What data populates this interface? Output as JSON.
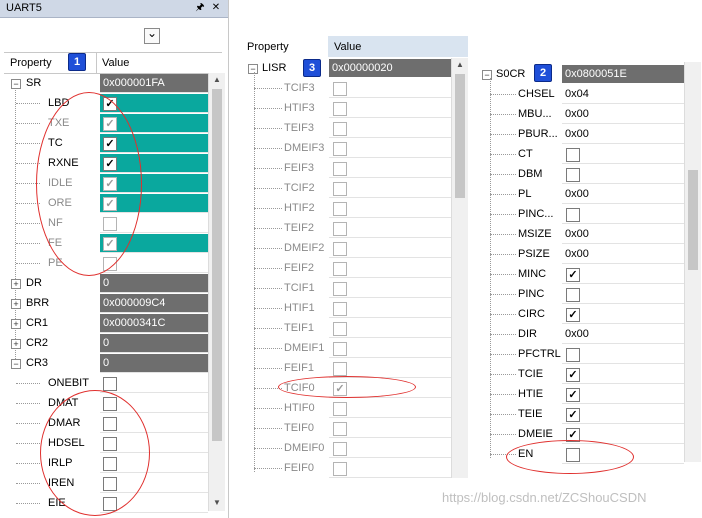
{
  "panel1": {
    "title": "UART5",
    "dropdown_arrow": "⌄",
    "pin_icon": "🖈",
    "close_icon": "✕",
    "badge": "1",
    "header": {
      "property": "Property",
      "value": "Value"
    },
    "rows": [
      {
        "name": "SR",
        "value": "0x000001FA",
        "kind": "group-open"
      },
      {
        "name": "LBD",
        "kind": "bit",
        "checked": true,
        "style": "teal"
      },
      {
        "name": "TXE",
        "kind": "bit",
        "checked": true,
        "style": "teal",
        "disabled": true
      },
      {
        "name": "TC",
        "kind": "bit",
        "checked": true,
        "style": "teal"
      },
      {
        "name": "RXNE",
        "kind": "bit",
        "checked": true,
        "style": "teal"
      },
      {
        "name": "IDLE",
        "kind": "bit",
        "checked": true,
        "style": "teal",
        "disabled": true
      },
      {
        "name": "ORE",
        "kind": "bit",
        "checked": true,
        "style": "teal",
        "disabled": true
      },
      {
        "name": "NF",
        "kind": "bit",
        "checked": false,
        "style": "none",
        "disabled": true
      },
      {
        "name": "FE",
        "kind": "bit",
        "checked": true,
        "style": "teal",
        "disabled": true
      },
      {
        "name": "PE",
        "kind": "bit",
        "checked": false,
        "style": "none",
        "disabled": true
      },
      {
        "name": "DR",
        "value": "0",
        "kind": "group-closed"
      },
      {
        "name": "BRR",
        "value": "0x000009C4",
        "kind": "group-closed"
      },
      {
        "name": "CR1",
        "value": "0x0000341C",
        "kind": "group-closed"
      },
      {
        "name": "CR2",
        "value": "0",
        "kind": "group-closed"
      },
      {
        "name": "CR3",
        "value": "0",
        "kind": "group-open"
      },
      {
        "name": "ONEBIT",
        "kind": "bit",
        "checked": false,
        "style": "none"
      },
      {
        "name": "DMAT",
        "kind": "bit",
        "checked": false,
        "style": "none"
      },
      {
        "name": "DMAR",
        "kind": "bit",
        "checked": false,
        "style": "none"
      },
      {
        "name": "HDSEL",
        "kind": "bit",
        "checked": false,
        "style": "none"
      },
      {
        "name": "IRLP",
        "kind": "bit",
        "checked": false,
        "style": "none"
      },
      {
        "name": "IREN",
        "kind": "bit",
        "checked": false,
        "style": "none"
      },
      {
        "name": "EIE",
        "kind": "bit",
        "checked": false,
        "style": "none"
      }
    ]
  },
  "panel3": {
    "badge": "3",
    "header": {
      "property": "Property",
      "value": "Value"
    },
    "group": {
      "name": "LISR",
      "value": "0x00000020"
    },
    "bits": [
      {
        "name": "TCIF3",
        "checked": false
      },
      {
        "name": "HTIF3",
        "checked": false
      },
      {
        "name": "TEIF3",
        "checked": false
      },
      {
        "name": "DMEIF3",
        "checked": false
      },
      {
        "name": "FEIF3",
        "checked": false
      },
      {
        "name": "TCIF2",
        "checked": false
      },
      {
        "name": "HTIF2",
        "checked": false
      },
      {
        "name": "TEIF2",
        "checked": false
      },
      {
        "name": "DMEIF2",
        "checked": false
      },
      {
        "name": "FEIF2",
        "checked": false
      },
      {
        "name": "TCIF1",
        "checked": false
      },
      {
        "name": "HTIF1",
        "checked": false
      },
      {
        "name": "TEIF1",
        "checked": false
      },
      {
        "name": "DMEIF1",
        "checked": false
      },
      {
        "name": "FEIF1",
        "checked": false
      },
      {
        "name": "TCIF0",
        "checked": true
      },
      {
        "name": "HTIF0",
        "checked": false
      },
      {
        "name": "TEIF0",
        "checked": false
      },
      {
        "name": "DMEIF0",
        "checked": false
      },
      {
        "name": "FEIF0",
        "checked": false
      }
    ]
  },
  "panel2": {
    "badge": "2",
    "group": {
      "name": "S0CR",
      "value": "0x0800051E"
    },
    "rows": [
      {
        "name": "CHSEL",
        "type": "text",
        "value": "0x04"
      },
      {
        "name": "MBU...",
        "type": "text",
        "value": "0x00"
      },
      {
        "name": "PBUR...",
        "type": "text",
        "value": "0x00"
      },
      {
        "name": "CT",
        "type": "check",
        "checked": false
      },
      {
        "name": "DBM",
        "type": "check",
        "checked": false
      },
      {
        "name": "PL",
        "type": "text",
        "value": "0x00"
      },
      {
        "name": "PINC...",
        "type": "check",
        "checked": false
      },
      {
        "name": "MSIZE",
        "type": "text",
        "value": "0x00"
      },
      {
        "name": "PSIZE",
        "type": "text",
        "value": "0x00"
      },
      {
        "name": "MINC",
        "type": "check",
        "checked": true
      },
      {
        "name": "PINC",
        "type": "check",
        "checked": false
      },
      {
        "name": "CIRC",
        "type": "check",
        "checked": true
      },
      {
        "name": "DIR",
        "type": "text",
        "value": "0x00"
      },
      {
        "name": "PFCTRL",
        "type": "check",
        "checked": false
      },
      {
        "name": "TCIE",
        "type": "check",
        "checked": true
      },
      {
        "name": "HTIE",
        "type": "check",
        "checked": true
      },
      {
        "name": "TEIE",
        "type": "check",
        "checked": true
      },
      {
        "name": "DMEIE",
        "type": "check",
        "checked": true
      },
      {
        "name": "EN",
        "type": "check",
        "checked": false
      }
    ]
  },
  "watermark": "https://blog.csdn.net/ZCShouCSDN",
  "colors": {
    "teal": "#0aa89e",
    "dark": "#6e6e6e",
    "annot": "#e0302e",
    "badge": "#1f4fd8"
  }
}
